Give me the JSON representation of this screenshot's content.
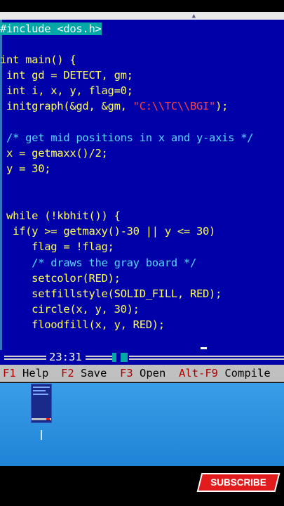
{
  "editor": {
    "lines": [
      {
        "t": "#include <dos.h>"
      },
      {
        "t": ""
      },
      {
        "t": "int main() {"
      },
      {
        "t": " int gd = DETECT, gm;"
      },
      {
        "t": " int i, x, y, flag=0;"
      },
      {
        "a": " initgraph(&gd, &gm, ",
        "b": "\"C:\\\\TC\\\\BGI\"",
        "c": ");"
      },
      {
        "t": ""
      },
      {
        "t": " /* get mid positions in x and y-axis */"
      },
      {
        "t": " x = getmaxx()/2;"
      },
      {
        "t": " y = 30;"
      },
      {
        "t": ""
      },
      {
        "t": ""
      },
      {
        "t": " while (!kbhit()) {"
      },
      {
        "t": "  if(y >= getmaxy()-30 || y <= 30)"
      },
      {
        "t": "     flag = !flag;"
      },
      {
        "t": "     /* draws the gray board */"
      },
      {
        "t": "     setcolor(RED);"
      },
      {
        "t": "     setfillstyle(SOLID_FILL, RED);"
      },
      {
        "t": "     circle(x, y, 30);"
      },
      {
        "t": "     floodfill(x, y, RED);"
      }
    ]
  },
  "status": {
    "cursor_position": "23:31"
  },
  "menu": {
    "items": [
      {
        "key": "F1",
        "label": "Help"
      },
      {
        "key": "F2",
        "label": "Save"
      },
      {
        "key": "F3",
        "label": "Open"
      },
      {
        "key": "Alt-F9",
        "label": "Compile"
      }
    ]
  },
  "overlay": {
    "subscribe_label": "SUBSCRIBE"
  },
  "colors": {
    "editor_bg": "#0000a8",
    "code_text": "#ffff57",
    "comment": "#57d7ff",
    "string": "#ff4040",
    "menu_bg": "#c0c0c0",
    "menu_key": "#b00000",
    "subscribe_red": "#e21c1c"
  }
}
